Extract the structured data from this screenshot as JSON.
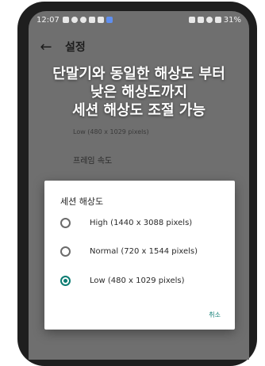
{
  "status_bar": {
    "time": "12:07",
    "battery": "31%"
  },
  "toolbar": {
    "title": "설정"
  },
  "settings": {
    "resolution_summary": "Low (480 x 1029 pixels)",
    "frame_rate_title": "프레임 속도"
  },
  "caption": {
    "lines": [
      "단말기와 동일한 해상도 부터",
      "낮은 해상도까지",
      "세션 해상도 조절 가능"
    ]
  },
  "dialog": {
    "title": "세션 해상도",
    "options": [
      {
        "label": "High (1440 x 3088 pixels)",
        "selected": false
      },
      {
        "label": "Normal (720 x 1544 pixels)",
        "selected": false
      },
      {
        "label": "Low (480 x 1029 pixels)",
        "selected": true
      }
    ],
    "cancel_label": "취소"
  },
  "colors": {
    "accent": "#0c7c72",
    "scrim": "#6f6f6f"
  }
}
